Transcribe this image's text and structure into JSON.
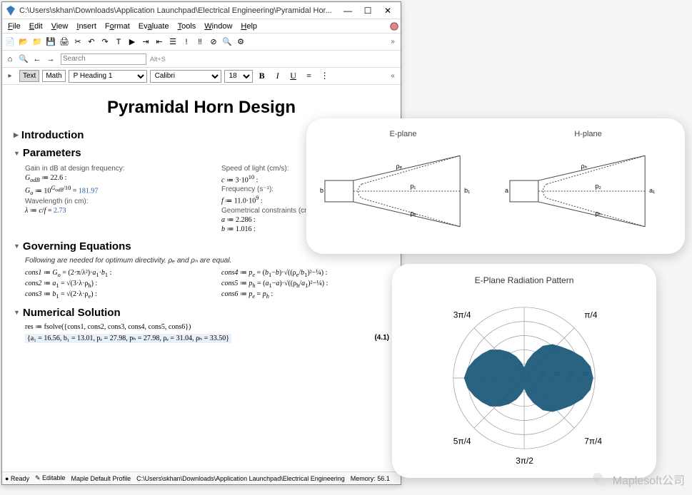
{
  "window": {
    "title": "C:\\Users\\skhan\\Downloads\\Application Launchpad\\Electrical Engineering\\Pyramidal Hor..."
  },
  "menus": [
    "File",
    "Edit",
    "View",
    "Insert",
    "Format",
    "Evaluate",
    "Tools",
    "Window",
    "Help"
  ],
  "search": {
    "placeholder": "Search",
    "shortcut": "Alt+S"
  },
  "format": {
    "tab_text": "Text",
    "tab_math": "Math",
    "style": "P Heading 1",
    "font": "Calibri",
    "size": "18",
    "bold": "B",
    "italic": "I",
    "underline": "U"
  },
  "doc": {
    "title": "Pyramidal Horn Design",
    "sections": {
      "intro": "Introduction",
      "params": "Parameters",
      "governing": "Governing Equations",
      "numerical": "Numerical Solution"
    },
    "params": {
      "gain_label": "Gain in dB at design frequency:",
      "godb": "Gₒ_dB ≔ 22.6 :",
      "go": "Gₒ ≔ 10^(Gₒ_dB/10) = 181.97",
      "wavelength_label": "Wavelength (in cm):",
      "lambda": "λ ≔ c/f = 2.73",
      "speed_label": "Speed of light (cm/s):",
      "c": "c ≔ 3·10¹⁰ :",
      "freq_label": "Frequency (s⁻¹):",
      "f": "f ≔ 11.0·10⁹ :",
      "geom_label": "Geometrical constraints (cm):",
      "a": "a ≔ 2.286 :",
      "b": "b ≔ 1.016 :"
    },
    "governing": {
      "note": "Following are needed for optimum directivity. ρₑ and ρₕ are equal.",
      "cons1": "cons1 ≔ Gₒ = (2·π/λ²)·a₁·b₁ :",
      "cons2": "cons2 ≔ a₁ = √(3·λ·ρₕ) :",
      "cons3": "cons3 ≔ b₁ = √(2·λ·ρₑ) :",
      "cons4": "cons4 ≔ pₑ = (b₁ − b)·√((ρₑ/b₁)² − 1/4) :",
      "cons5": "cons5 ≔ pₕ = (a₁ − a)·√((ρₕ/a₁)² − 1/4) :",
      "cons6": "cons6 ≔ pₑ = pₕ :"
    },
    "numerical": {
      "res": "res ≔ fsolve({cons1, cons2, cons3, cons4, cons5, cons6})",
      "result": "{a₁ = 16.56, b₁ = 13.01, pₑ = 27.98, pₕ = 27.98, ρₑ = 31.04, ρₕ = 33.50}",
      "eqnum": "(4.1)"
    }
  },
  "statusbar": {
    "ready": "● Ready",
    "editable": "✎ Editable",
    "profile": "Maple Default Profile",
    "path": "C:\\Users\\skhan\\Downloads\\Application Launchpad\\Electrical Engineering",
    "memory": "Memory: 56.1"
  },
  "panel1": {
    "e_plane": "E-plane",
    "h_plane": "H-plane",
    "rho_e": "ρₑ",
    "rho_h": "ρₕ",
    "p1": "p₁",
    "p2": "p₂",
    "b": "b",
    "a": "a",
    "b1": "b₁",
    "a1": "a₁",
    "pe": "pₑ",
    "ph": "pₕ"
  },
  "panel2": {
    "title": "E-Plane Radiation Pattern",
    "ticks": {
      "pi4": "π/4",
      "3pi4": "3π/4",
      "5pi4": "5π/4",
      "7pi4": "7π/4",
      "3pi2": "3π/2"
    },
    "radial": [
      "0",
      "20",
      "40",
      "60",
      "80"
    ]
  },
  "chart_data": {
    "type": "polar",
    "title": "E-Plane Radiation Pattern",
    "radial_range": [
      0,
      80
    ],
    "radial_ticks": [
      0,
      20,
      40,
      60,
      80
    ],
    "angular_ticks_deg": [
      45,
      135,
      225,
      270,
      315
    ],
    "series": [
      {
        "name": "E-plane",
        "color": "#1e5b7a",
        "angles_deg": [
          0,
          10,
          20,
          30,
          40,
          50,
          60,
          70,
          80,
          90,
          100,
          110,
          120,
          130,
          140,
          150,
          160,
          170,
          180,
          190,
          200,
          210,
          220,
          230,
          240,
          250,
          260,
          270,
          280,
          290,
          300,
          310,
          320,
          330,
          340,
          350
        ],
        "values": [
          78,
          76,
          70,
          62,
          55,
          50,
          42,
          30,
          20,
          12,
          18,
          26,
          34,
          42,
          50,
          55,
          60,
          65,
          68,
          65,
          60,
          55,
          50,
          42,
          34,
          26,
          18,
          12,
          20,
          30,
          42,
          50,
          55,
          62,
          70,
          76
        ]
      }
    ]
  },
  "watermark": "Maplesoft公司"
}
